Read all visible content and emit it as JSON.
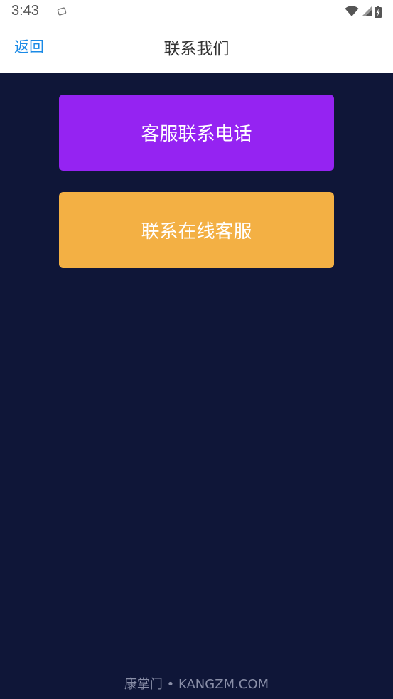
{
  "status_bar": {
    "time": "3:43",
    "icons": [
      "notification-icon",
      "wifi-icon",
      "signal-icon",
      "battery-charging-icon"
    ]
  },
  "nav": {
    "back_label": "返回",
    "title": "联系我们"
  },
  "buttons": {
    "phone": {
      "label": "客服联系电话",
      "color": "#9523f2"
    },
    "online": {
      "label": "联系在线客服",
      "color": "#f3b044"
    }
  },
  "watermark": "康掌门 • KANGZM.COM",
  "colors": {
    "background": "#0f1638",
    "nav_background": "#ffffff",
    "back_link": "#1a8ae6"
  }
}
